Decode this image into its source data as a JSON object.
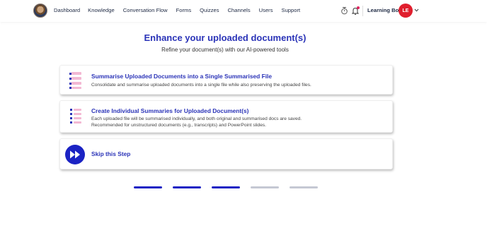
{
  "nav": {
    "items": [
      "Dashboard",
      "Knowledge",
      "Conversation Flow",
      "Forms",
      "Quizzes",
      "Channels",
      "Users",
      "Support"
    ]
  },
  "header": {
    "bot_name": "Learning Bot",
    "avatar_initials": "LE",
    "icons": [
      "logo",
      "alarm-icon",
      "bell-icon",
      "chevron-down-icon"
    ]
  },
  "main": {
    "title": "Enhance your uploaded document(s)",
    "subtitle": "Refine your document(s) with our AI-powered tools",
    "options": [
      {
        "title": "Summarise Uploaded Documents into a Single Summarised File",
        "description": "Consolidate and summarise uploaded documents into a single file while also preserving the uploaded files."
      },
      {
        "title": "Create Individual Summaries for Uploaded Document(s)",
        "description_line1": "Each uploaded file will be summarised individually, and both original and summarised docs are saved.",
        "description_line2": "Recommended for unstructured documents (e.g., transcripts) and PowerPoint slides."
      },
      {
        "title": "Skip this Step"
      }
    ]
  },
  "progress": {
    "total_steps": 5,
    "completed_steps": 3,
    "colors": {
      "active": "#1b23c4",
      "inactive": "#c5c8d3"
    }
  },
  "colors": {
    "accent": "#2b34b8",
    "avatar": "#e01e2d",
    "notification": "#e0245e"
  }
}
